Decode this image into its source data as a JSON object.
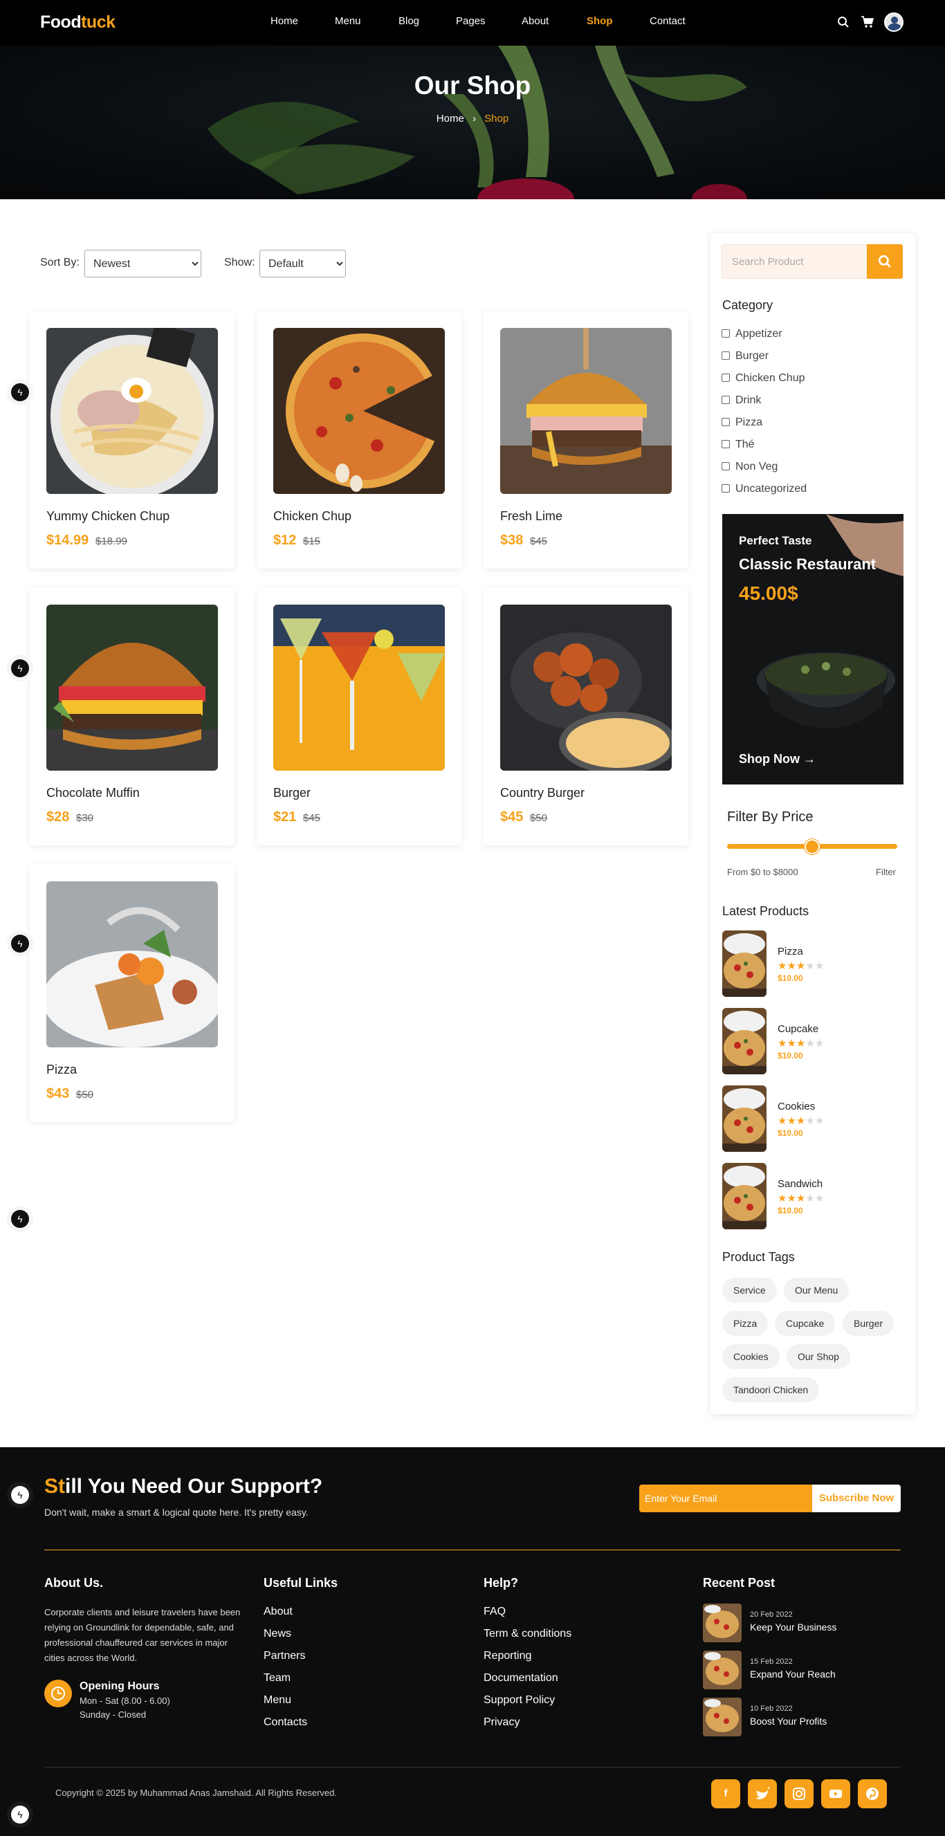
{
  "brand": {
    "logo_part1": "Food",
    "logo_part2": "tuck",
    "accent": "#f8a11b"
  },
  "nav": {
    "items": [
      "Home",
      "Menu",
      "Blog",
      "Pages",
      "About",
      "Shop",
      "Contact"
    ],
    "active": "Shop",
    "icons": [
      "search-icon",
      "cart-icon",
      "avatar"
    ]
  },
  "hero": {
    "title": "Our Shop",
    "crumb_home": "Home",
    "crumb_current": "Shop"
  },
  "controls": {
    "sort_label": "Sort By:",
    "sort_value": "Newest",
    "show_label": "Show:",
    "show_value": "Default"
  },
  "products": [
    {
      "name": "Yummy Chicken Chup",
      "price": "$14.99",
      "old": "$18.99"
    },
    {
      "name": "Chicken Chup",
      "price": "$12",
      "old": "$15"
    },
    {
      "name": "Fresh Lime",
      "price": "$38",
      "old": "$45"
    },
    {
      "name": "Chocolate Muffin",
      "price": "$28",
      "old": "$30"
    },
    {
      "name": "Burger",
      "price": "$21",
      "old": "$45"
    },
    {
      "name": "Country Burger",
      "price": "$45",
      "old": "$50"
    },
    {
      "name": "Pizza",
      "price": "$43",
      "old": "$50"
    }
  ],
  "sidebar": {
    "search_placeholder": "Search Product",
    "category_title": "Category",
    "categories": [
      "Appetizer",
      "Burger",
      "Chicken Chup",
      "Drink",
      "Pizza",
      "Thé",
      "Non Veg",
      "Uncategorized"
    ],
    "promo": {
      "eyebrow": "Perfect Taste",
      "title": "Classic Restaurant",
      "price": "45.00$",
      "cta": "Shop Now"
    },
    "price_filter": {
      "title": "Filter By Price",
      "range_text": "From $0 to $8000",
      "filter_label": "Filter",
      "handle_position": 0.5
    },
    "latest_title": "Latest Products",
    "latest": [
      {
        "name": "Pizza",
        "price": "$10.00",
        "rating": 3
      },
      {
        "name": "Cupcake",
        "price": "$10.00",
        "rating": 3
      },
      {
        "name": "Cookies",
        "price": "$10.00",
        "rating": 3
      },
      {
        "name": "Sandwich",
        "price": "$10.00",
        "rating": 3
      }
    ],
    "tags_title": "Product Tags",
    "tags": [
      "Service",
      "Our Menu",
      "Pizza",
      "Cupcake",
      "Burger",
      "Cookies",
      "Our Shop",
      "Tandoori Chicken"
    ]
  },
  "footer": {
    "support_title_accent": "St",
    "support_title_rest": "ill You Need Our Support?",
    "support_sub": "Don't wait, make a smart & logical quote here. It's pretty easy.",
    "email_placeholder": "Enter Your Email",
    "subscribe": "Subscribe Now",
    "about_title": "About Us.",
    "about_text": "Corporate clients and leisure travelers have been relying on Groundlink for dependable, safe, and professional chauffeured car services in major cities across the World.",
    "hours_title": "Opening Hours",
    "hours_line1": "Mon - Sat (8.00 - 6.00)",
    "hours_line2": "Sunday - Closed",
    "useful_title": "Useful Links",
    "useful": [
      "About",
      "News",
      "Partners",
      "Team",
      "Menu",
      "Contacts"
    ],
    "help_title": "Help?",
    "help": [
      "FAQ",
      "Term & conditions",
      "Reporting",
      "Documentation",
      "Support Policy",
      "Privacy"
    ],
    "recent_title": "Recent Post",
    "recent": [
      {
        "date": "20 Feb 2022",
        "title": "Keep Your Business"
      },
      {
        "date": "15 Feb 2022",
        "title": "Expand Your Reach"
      },
      {
        "date": "10 Feb 2022",
        "title": "Boost Your Profits"
      }
    ],
    "copyright": "Copyright © 2025 by Muhammad Anas Jamshaid. All Rights Reserved.",
    "social": [
      "facebook-icon",
      "twitter-icon",
      "instagram-icon",
      "youtube-icon",
      "pinterest-icon"
    ]
  }
}
